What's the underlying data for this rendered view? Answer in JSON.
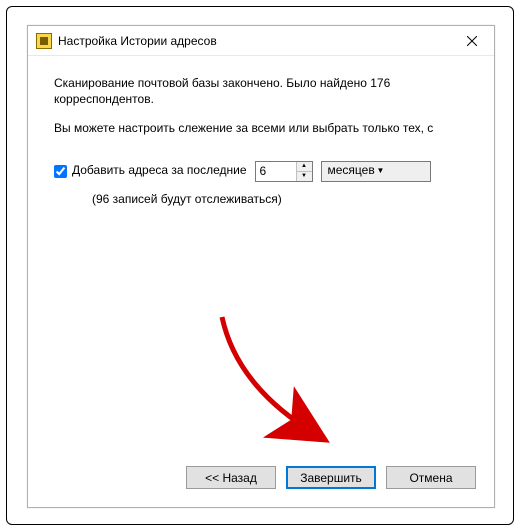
{
  "window": {
    "title": "Настройка Истории адресов"
  },
  "content": {
    "scan_result": "Сканирование почтовой базы закончено. Было найдено 176 корреспондентов.",
    "instruction": "Вы можете настроить слежение за всеми или выбрать только тех, с"
  },
  "form": {
    "checkbox_label": "Добавить адреса за последние",
    "period_value": "6",
    "period_unit": "месяцев",
    "tracking_note": "(96 записей будут отслеживаться)"
  },
  "buttons": {
    "back": "<<  Назад",
    "finish": "Завершить",
    "cancel": "Отмена"
  }
}
